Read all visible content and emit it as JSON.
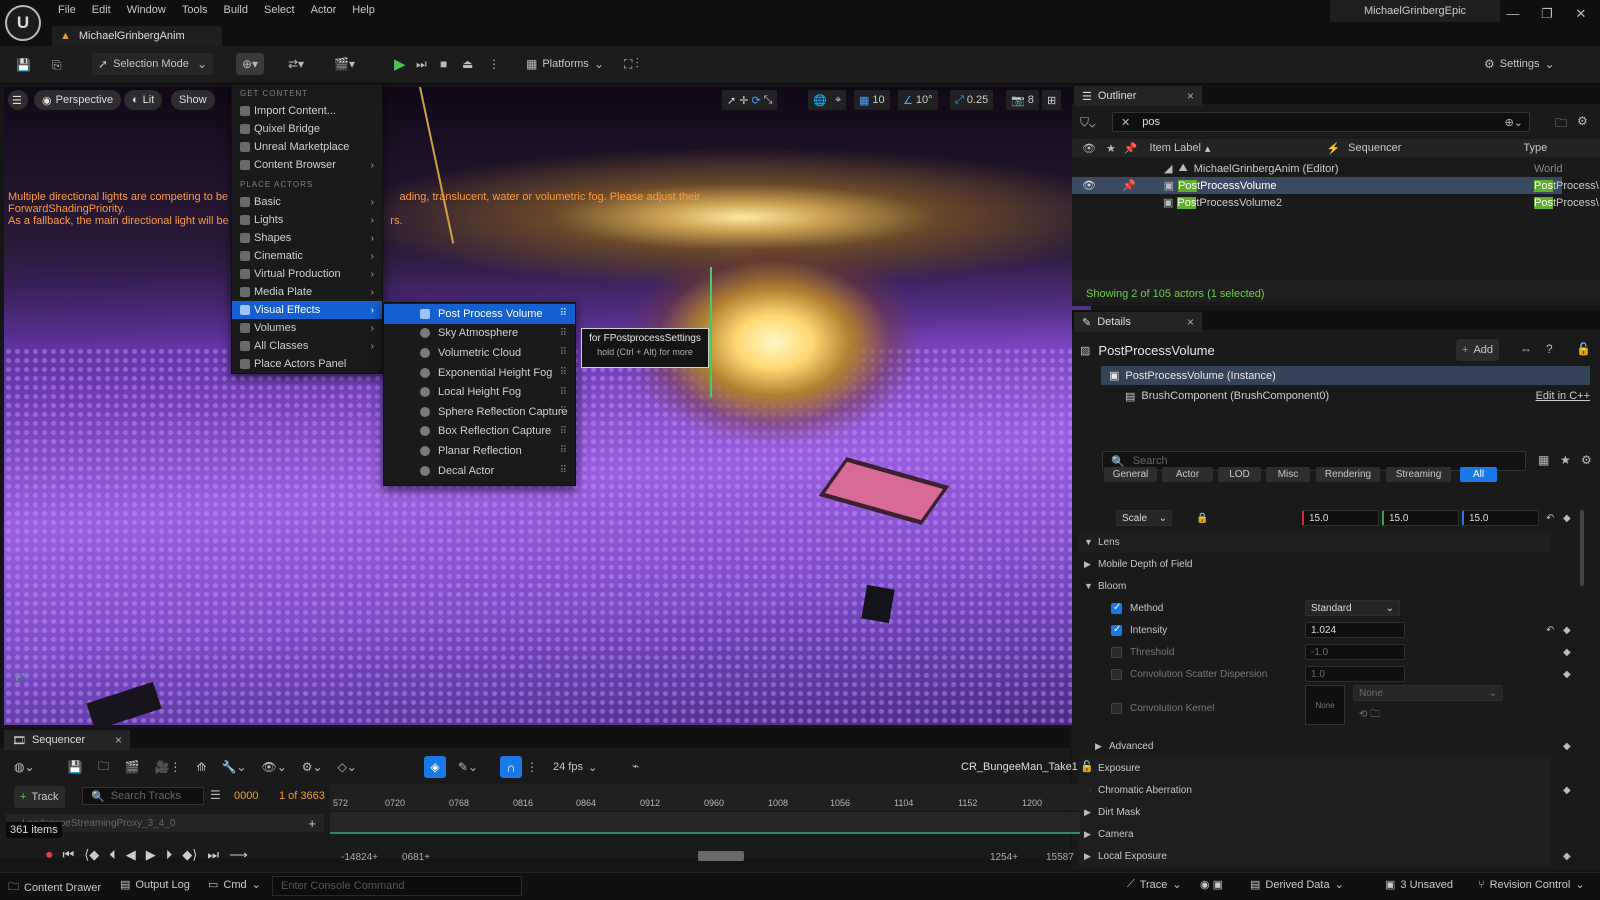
{
  "app": {
    "menu": [
      "File",
      "Edit",
      "Window",
      "Tools",
      "Build",
      "Select",
      "Actor",
      "Help"
    ],
    "project_tab": "MichaelGrinbergAnim",
    "project_name": "MichaelGrinbergEpic"
  },
  "toolbar": {
    "selection_mode": "Selection Mode",
    "platforms": "Platforms",
    "settings": "Settings"
  },
  "viewport": {
    "perspective": "Perspective",
    "lit": "Lit",
    "show": "Show",
    "snap_grid": "10",
    "snap_angle": "10°",
    "snap_scale": "0.25",
    "camera_speed": "8",
    "warning_line1": "Multiple directional lights are competing to be the",
    "warning_line1b": "ading, translucent, water or volumetric fog. Please adjust their ForwardShadingPriority.",
    "warning_line2": "As a fallback, the main directional light will be s",
    "warning_line2b": "rs."
  },
  "add_menu": {
    "header_get": "GET CONTENT",
    "get_items": [
      "Import Content...",
      "Quixel Bridge",
      "Unreal Marketplace",
      "Content Browser"
    ],
    "header_place": "PLACE ACTORS",
    "place_items": [
      "Basic",
      "Lights",
      "Shapes",
      "Cinematic",
      "Virtual Production",
      "Media Plate",
      "Visual Effects",
      "Volumes",
      "All Classes",
      "Place Actors Panel"
    ],
    "selected": "Visual Effects"
  },
  "submenu": {
    "items": [
      "Post Process Volume",
      "Sky Atmosphere",
      "Volumetric Cloud",
      "Exponential Height Fog",
      "Local Height Fog",
      "Sphere Reflection Capture",
      "Box Reflection Capture",
      "Planar Reflection",
      "Decal Actor"
    ],
    "selected": "Post Process Volume"
  },
  "tooltip": {
    "title": "for FPostprocessSettings",
    "hint": "hold (Ctrl + Alt) for more"
  },
  "outliner": {
    "tab": "Outliner",
    "search": "pos",
    "columns": [
      "Item Label",
      "Sequencer",
      "Type"
    ],
    "root": "MichaelGrinbergAnim (Editor)",
    "root_type": "World",
    "items": [
      {
        "match": "Pos",
        "rest": "tProcessVolume",
        "type_match": "Pos",
        "type_rest": "tProcess\\"
      },
      {
        "match": "Pos",
        "rest": "tProcessVolume2",
        "type_match": "Pos",
        "type_rest": "tProcess\\"
      }
    ],
    "status": "Showing 2 of 105 actors (1 selected)"
  },
  "details": {
    "tab": "Details",
    "title": "PostProcessVolume",
    "add": "Add",
    "instance": "PostProcessVolume (Instance)",
    "component": "BrushComponent (BrushComponent0)",
    "edit_cpp": "Edit in C++",
    "search_placeholder": "Search",
    "filters": [
      "General",
      "Actor",
      "LOD",
      "Misc",
      "Rendering",
      "Streaming",
      "All"
    ],
    "active_filter": "All",
    "scale_label": "Scale",
    "scale": [
      "15.0",
      "15.0",
      "15.0"
    ],
    "lens": "Lens",
    "mobile_dof": "Mobile Depth of Field",
    "bloom": "Bloom",
    "method_label": "Method",
    "method_value": "Standard",
    "intensity_label": "Intensity",
    "intensity_value": "1.024",
    "threshold_label": "Threshold",
    "threshold_value": "-1.0",
    "conv_scatter_label": "Convolution Scatter Dispersion",
    "conv_scatter_value": "1.0",
    "conv_kernel_label": "Convolution Kernel",
    "conv_kernel_thumb": "None",
    "conv_kernel_value": "None",
    "advanced": "Advanced",
    "exposure": "Exposure",
    "chromatic": "Chromatic Aberration",
    "dirt_mask": "Dirt Mask",
    "camera": "Camera",
    "local_exposure": "Local Exposure"
  },
  "sequencer": {
    "tab": "Sequencer",
    "track_button": "Track",
    "search_placeholder": "Search Tracks",
    "frame": "0000",
    "frame_count": "1 of 3663",
    "fps": "24 fps",
    "sequence_name": "CR_BungeeMan_Take1",
    "track_row": "LandscapeStreamingProxy_3_4_0",
    "items": "361 items",
    "ticks": [
      "572",
      "0720",
      "0768",
      "0816",
      "0864",
      "0912",
      "0960",
      "1008",
      "1056",
      "1104",
      "1152",
      "1200"
    ],
    "range_start": "-14824+",
    "view_start": "0681+",
    "view_end": "1254+",
    "range_end": "15587"
  },
  "statusbar": {
    "content_drawer": "Content Drawer",
    "output_log": "Output Log",
    "cmd": "Cmd",
    "console_placeholder": "Enter Console Command",
    "trace": "Trace",
    "derived_data": "Derived Data",
    "unsaved": "3 Unsaved",
    "revision_control": "Revision Control"
  },
  "colors": {
    "accent": "#1560d0",
    "filter_active": "#1a78e8",
    "match_highlight": "#5fae2e",
    "warning": "#ff9a3a"
  }
}
